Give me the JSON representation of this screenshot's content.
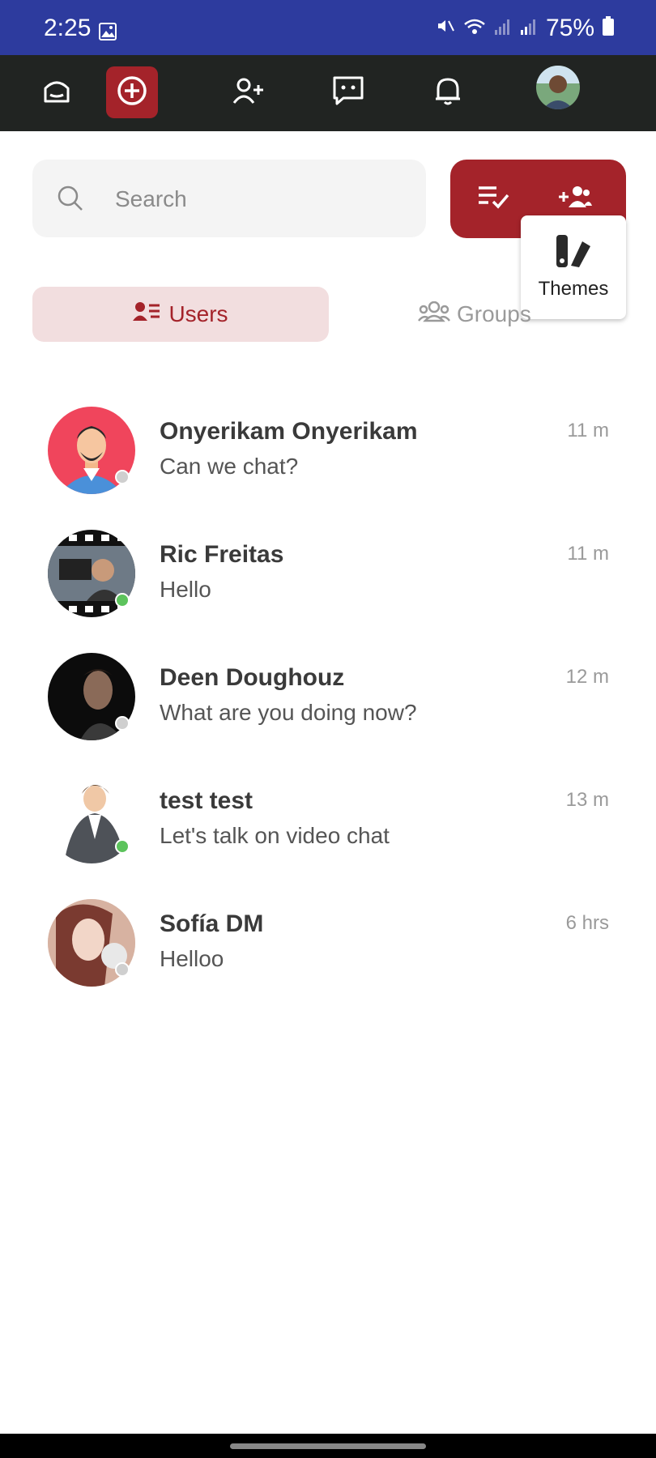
{
  "status": {
    "time": "2:25",
    "battery": "75%"
  },
  "nav": {
    "items": [
      {
        "icon": "home-icon"
      },
      {
        "icon": "plus-circle-icon"
      },
      {
        "icon": "add-user-icon"
      },
      {
        "icon": "message-icon"
      },
      {
        "icon": "bell-icon"
      }
    ],
    "avatar": "user-avatar"
  },
  "search": {
    "placeholder": "Search"
  },
  "actions": {
    "icons": [
      "checklist-icon",
      "add-group-icon"
    ]
  },
  "popover": {
    "label": "Themes",
    "icon": "themes-icon"
  },
  "tabs": {
    "users": "Users",
    "groups": "Groups"
  },
  "colors": {
    "brand": "#a4232a",
    "status_bar": "#2d3b9e",
    "nav": "#212422",
    "online": "#5cc35c",
    "offline": "#cfcfcf"
  },
  "chats": [
    {
      "name": "Onyerikam Onyerikam",
      "message": "Can we chat?",
      "time": "11 m",
      "online": false
    },
    {
      "name": "Ric Freitas",
      "message": "Hello",
      "time": "11 m",
      "online": true
    },
    {
      "name": "Deen Doughouz",
      "message": "What are you doing now?",
      "time": "12 m",
      "online": false
    },
    {
      "name": "test test",
      "message": "Let's talk on video chat",
      "time": "13 m",
      "online": true
    },
    {
      "name": "Sofía DM",
      "message": "Helloo",
      "time": "6 hrs",
      "online": false
    }
  ]
}
